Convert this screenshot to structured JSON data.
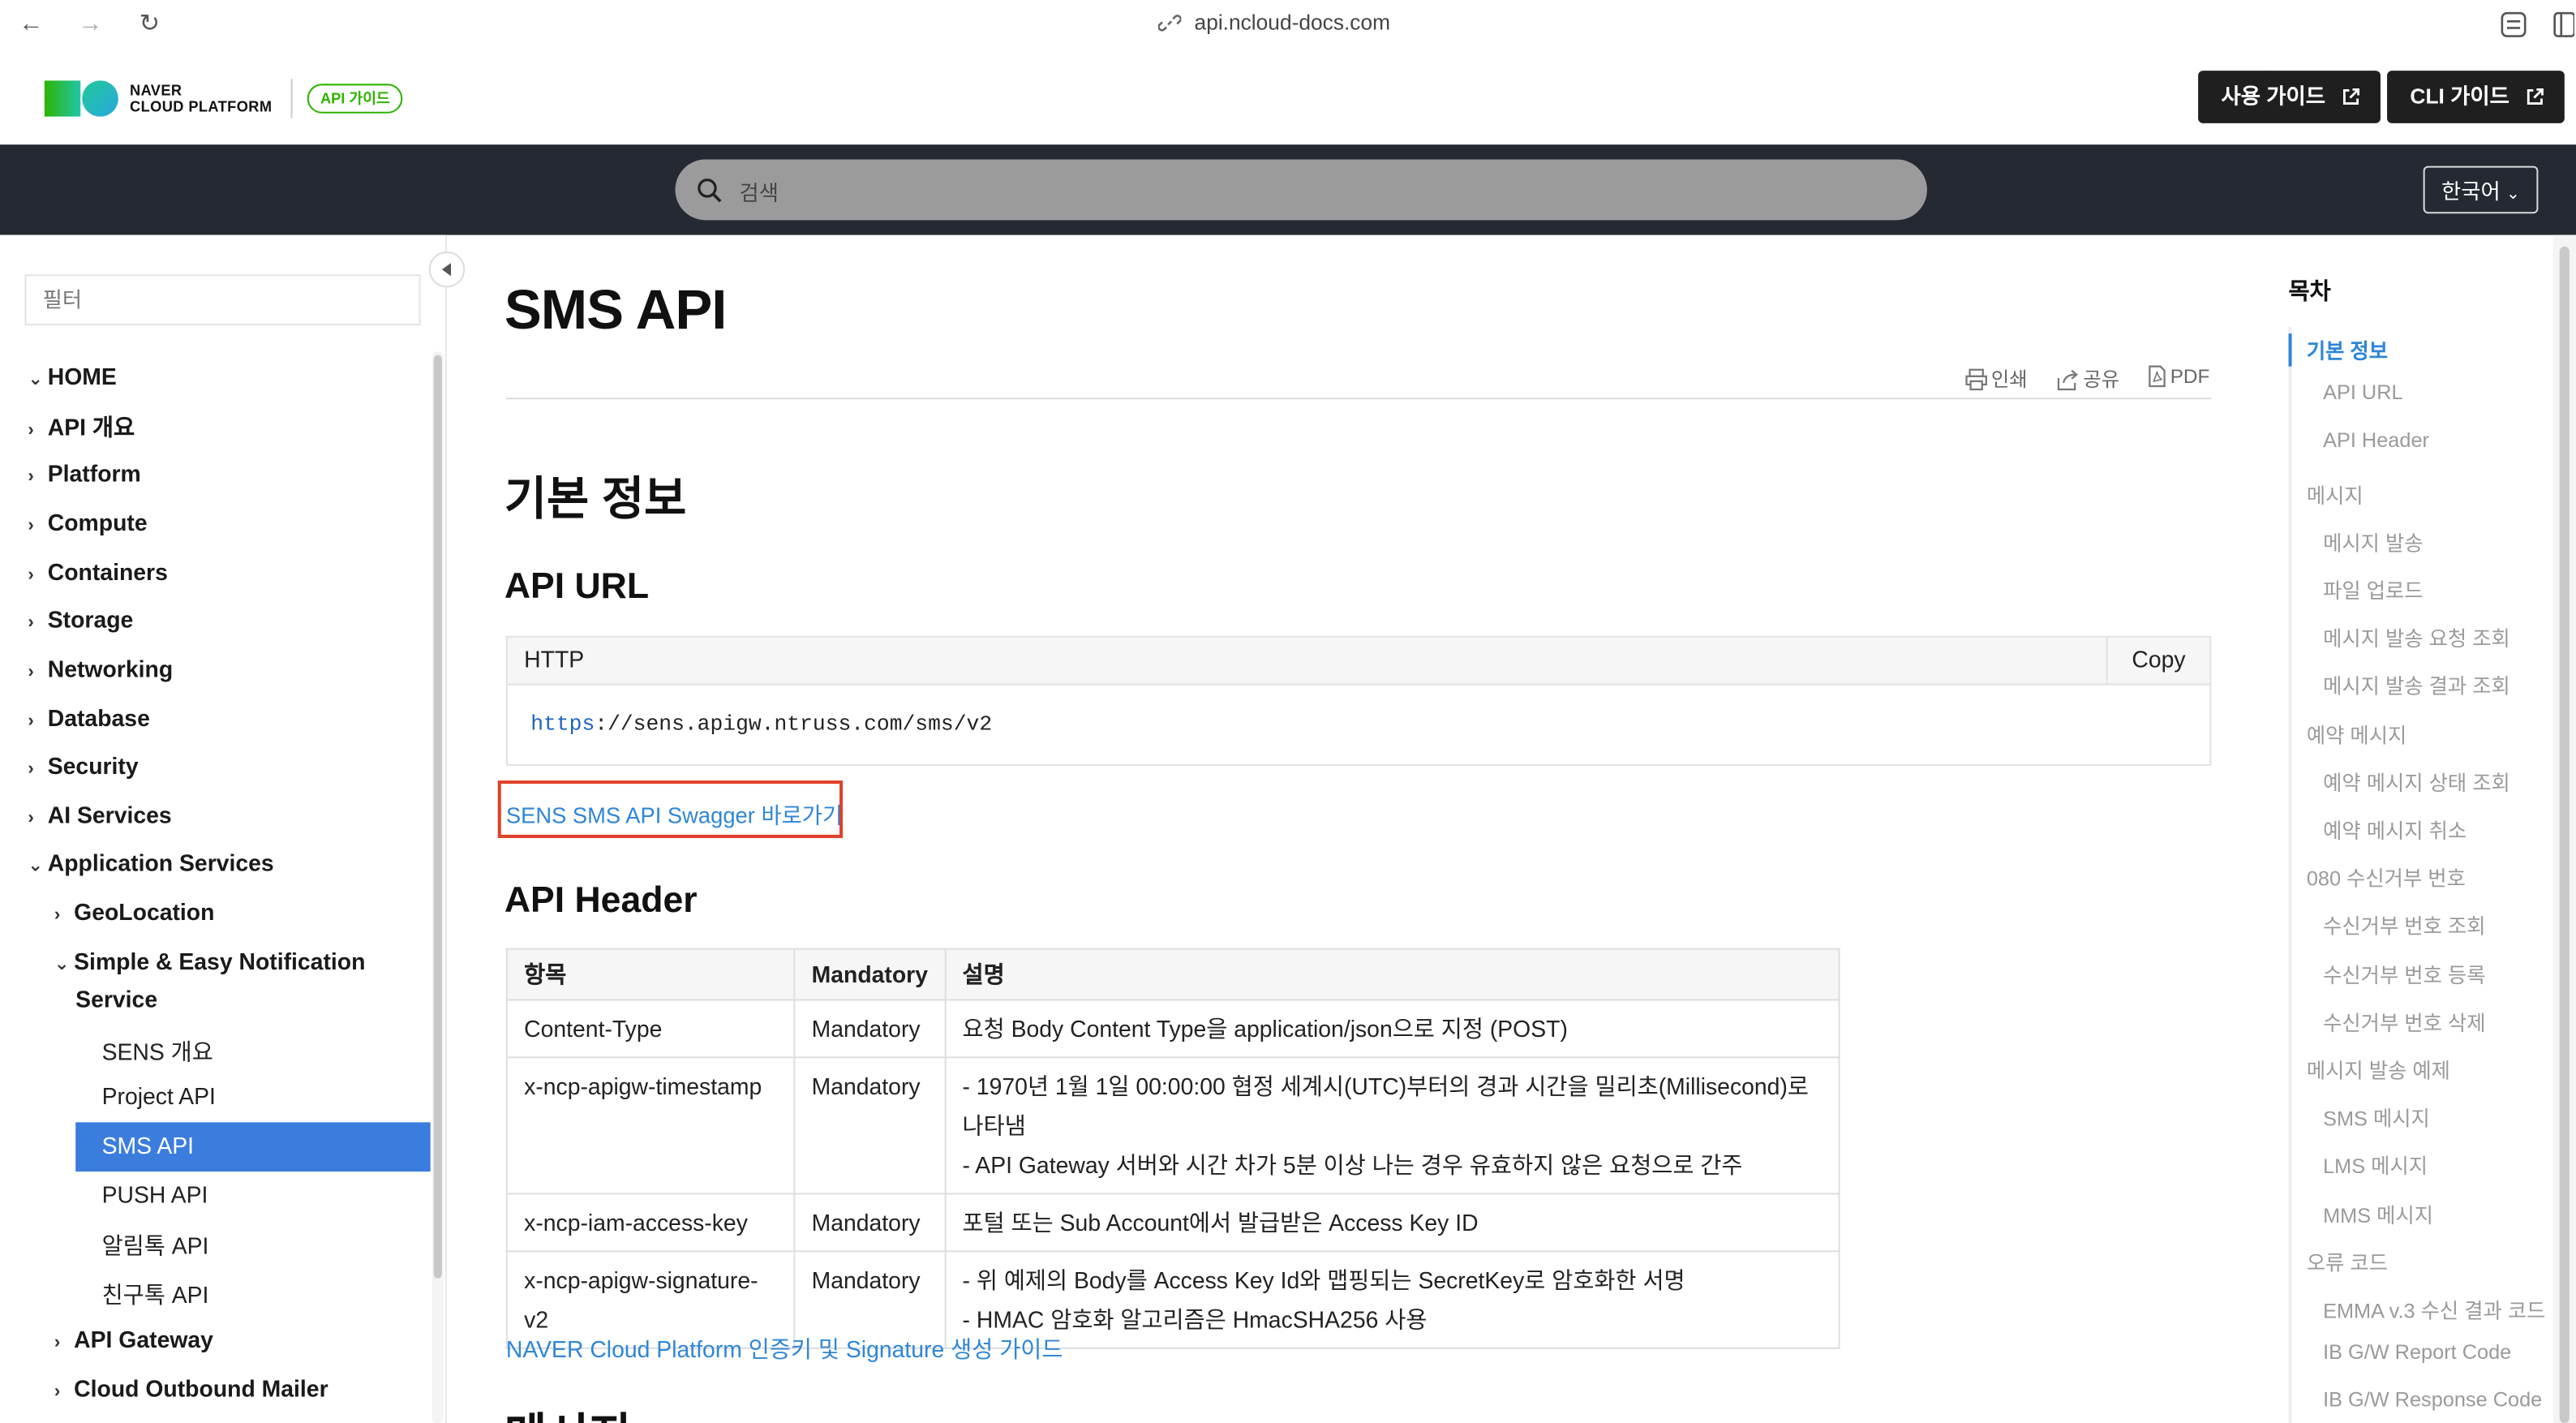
{
  "browser": {
    "url": "api.ncloud-docs.com",
    "back_icon": "←",
    "forward_icon": "→",
    "reload_icon": "↻"
  },
  "header": {
    "brand_line1": "NAVER",
    "brand_line2": "CLOUD PLATFORM",
    "badge": "API 가이드",
    "user_guide_button": "사용 가이드",
    "cli_guide_button": "CLI 가이드"
  },
  "search": {
    "placeholder": "검색",
    "language": "한국어"
  },
  "sidebar": {
    "filter_placeholder": "필터",
    "items": [
      {
        "label": "HOME",
        "arrow": "⌄"
      },
      {
        "label": "API 개요",
        "arrow": "›"
      },
      {
        "label": "Platform",
        "arrow": "›"
      },
      {
        "label": "Compute",
        "arrow": "›"
      },
      {
        "label": "Containers",
        "arrow": "›"
      },
      {
        "label": "Storage",
        "arrow": "›"
      },
      {
        "label": "Networking",
        "arrow": "›"
      },
      {
        "label": "Database",
        "arrow": "›"
      },
      {
        "label": "Security",
        "arrow": "›"
      },
      {
        "label": "AI Services",
        "arrow": "›"
      },
      {
        "label": "Application Services",
        "arrow": "⌄"
      }
    ],
    "sub_items": [
      {
        "label": "GeoLocation",
        "arrow": "›"
      },
      {
        "label": "Simple & Easy Notification",
        "label2": "Service",
        "arrow": "⌄"
      }
    ],
    "leaf_items": [
      "SENS 개요",
      "Project API",
      "SMS API",
      "PUSH API",
      "알림톡 API",
      "친구톡 API"
    ],
    "more_items": [
      {
        "label": "API Gateway",
        "arrow": "›"
      },
      {
        "label": "Cloud Outbound Mailer",
        "arrow": "›"
      }
    ]
  },
  "main": {
    "title": "SMS API",
    "tools": {
      "print": "인쇄",
      "share": "공유",
      "pdf": "PDF"
    },
    "section_basic": "기본 정보",
    "section_api_url": "API URL",
    "code": {
      "lang": "HTTP",
      "copy": "Copy",
      "scheme": "https",
      "rest": "://sens.apigw.ntruss.com/sms/v2"
    },
    "swagger_link": "SENS SMS API Swagger 바로가기",
    "section_api_header": "API Header",
    "table": {
      "headers": [
        "항목",
        "Mandatory",
        "설명"
      ],
      "rows": [
        {
          "name": "Content-Type",
          "mandatory": "Mandatory",
          "desc": [
            "요청 Body Content Type을 application/json으로 지정 (POST)"
          ]
        },
        {
          "name": "x-ncp-apigw-timestamp",
          "mandatory": "Mandatory",
          "desc": [
            "- 1970년 1월 1일 00:00:00 협정 세계시(UTC)부터의 경과 시간을 밀리초(Millisecond)로 나타냄",
            "- API Gateway 서버와 시간 차가 5분 이상 나는 경우 유효하지 않은 요청으로 간주"
          ]
        },
        {
          "name": "x-ncp-iam-access-key",
          "mandatory": "Mandatory",
          "desc": [
            "포털 또는 Sub Account에서 발급받은 Access Key ID"
          ]
        },
        {
          "name": "x-ncp-apigw-signature-v2",
          "mandatory": "Mandatory",
          "desc": [
            "- 위 예제의 Body를 Access Key Id와 맵핑되는 SecretKey로 암호화한 서명",
            "- HMAC 암호화 알고리즘은 HmacSHA256 사용"
          ]
        }
      ]
    },
    "guide_link": "NAVER Cloud Platform 인증키 및 Signature 생성 가이드",
    "next_section": "메시지"
  },
  "toc": {
    "title": "목차",
    "items": [
      {
        "label": "기본 정보",
        "level": 1,
        "active": true
      },
      {
        "label": "API URL",
        "level": 2
      },
      {
        "label": "API Header",
        "level": 2
      },
      {
        "label": "메시지",
        "level": 1
      },
      {
        "label": "메시지 발송",
        "level": 2
      },
      {
        "label": "파일 업로드",
        "level": 2
      },
      {
        "label": "메시지 발송 요청 조회",
        "level": 2
      },
      {
        "label": "메시지 발송 결과 조회",
        "level": 2
      },
      {
        "label": "예약 메시지",
        "level": 1
      },
      {
        "label": "예약 메시지 상태 조회",
        "level": 2
      },
      {
        "label": "예약 메시지 취소",
        "level": 2
      },
      {
        "label": "080 수신거부 번호",
        "level": 1
      },
      {
        "label": "수신거부 번호 조회",
        "level": 2
      },
      {
        "label": "수신거부 번호 등록",
        "level": 2
      },
      {
        "label": "수신거부 번호 삭제",
        "level": 2
      },
      {
        "label": "메시지 발송 예제",
        "level": 1
      },
      {
        "label": "SMS 메시지",
        "level": 2
      },
      {
        "label": "LMS 메시지",
        "level": 2
      },
      {
        "label": "MMS 메시지",
        "level": 2
      },
      {
        "label": "오류 코드",
        "level": 1
      },
      {
        "label": "EMMA v.3 수신 결과 코드",
        "level": 2
      },
      {
        "label": "IB G/W Report Code",
        "level": 2
      },
      {
        "label": "IB G/W Response Code",
        "level": 2
      }
    ]
  },
  "colors": {
    "accent": "#3b7ddd",
    "link": "#2f86d6",
    "brand_green": "#2db400",
    "dark_band": "#252a32",
    "highlight_box": "#e0402a"
  }
}
